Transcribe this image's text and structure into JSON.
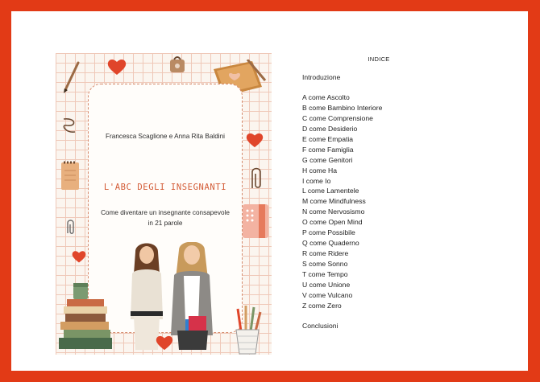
{
  "cover": {
    "authors": "Francesca Scaglione e Anna Rita Baldini",
    "title": "L'ABC DEGLI INSEGNANTI",
    "subtitle_line1": "Come diventare un insegnante consapevole",
    "subtitle_line2": "in 21 parole"
  },
  "index": {
    "title": "INDICE",
    "intro": "Introduzione",
    "items": [
      "A come Ascolto",
      "B come Bambino Interiore",
      "C come Comprensione",
      "D come Desiderio",
      "E come Empatia",
      "F come Famiglia",
      "G come Genitori",
      "H come Ha",
      "I come Io",
      "L come Lamentele",
      "M come Mindfulness",
      "N come Nervosismo",
      "O come Open Mind",
      "P come Possibile",
      "Q come Quaderno",
      "R come Ridere",
      "S come Sonno",
      "T come Tempo",
      "U come Unione",
      "V come Vulcano",
      "Z come Zero"
    ],
    "conclusion": "Conclusioni"
  },
  "colors": {
    "frame": "#e23a16",
    "accent": "#d35b36",
    "heart": "#e0452a"
  },
  "icons": [
    "heart-icon",
    "paperclip-icon",
    "notebook-icon",
    "pencil-icon",
    "book-stack-icon",
    "pencil-cup-icon"
  ]
}
